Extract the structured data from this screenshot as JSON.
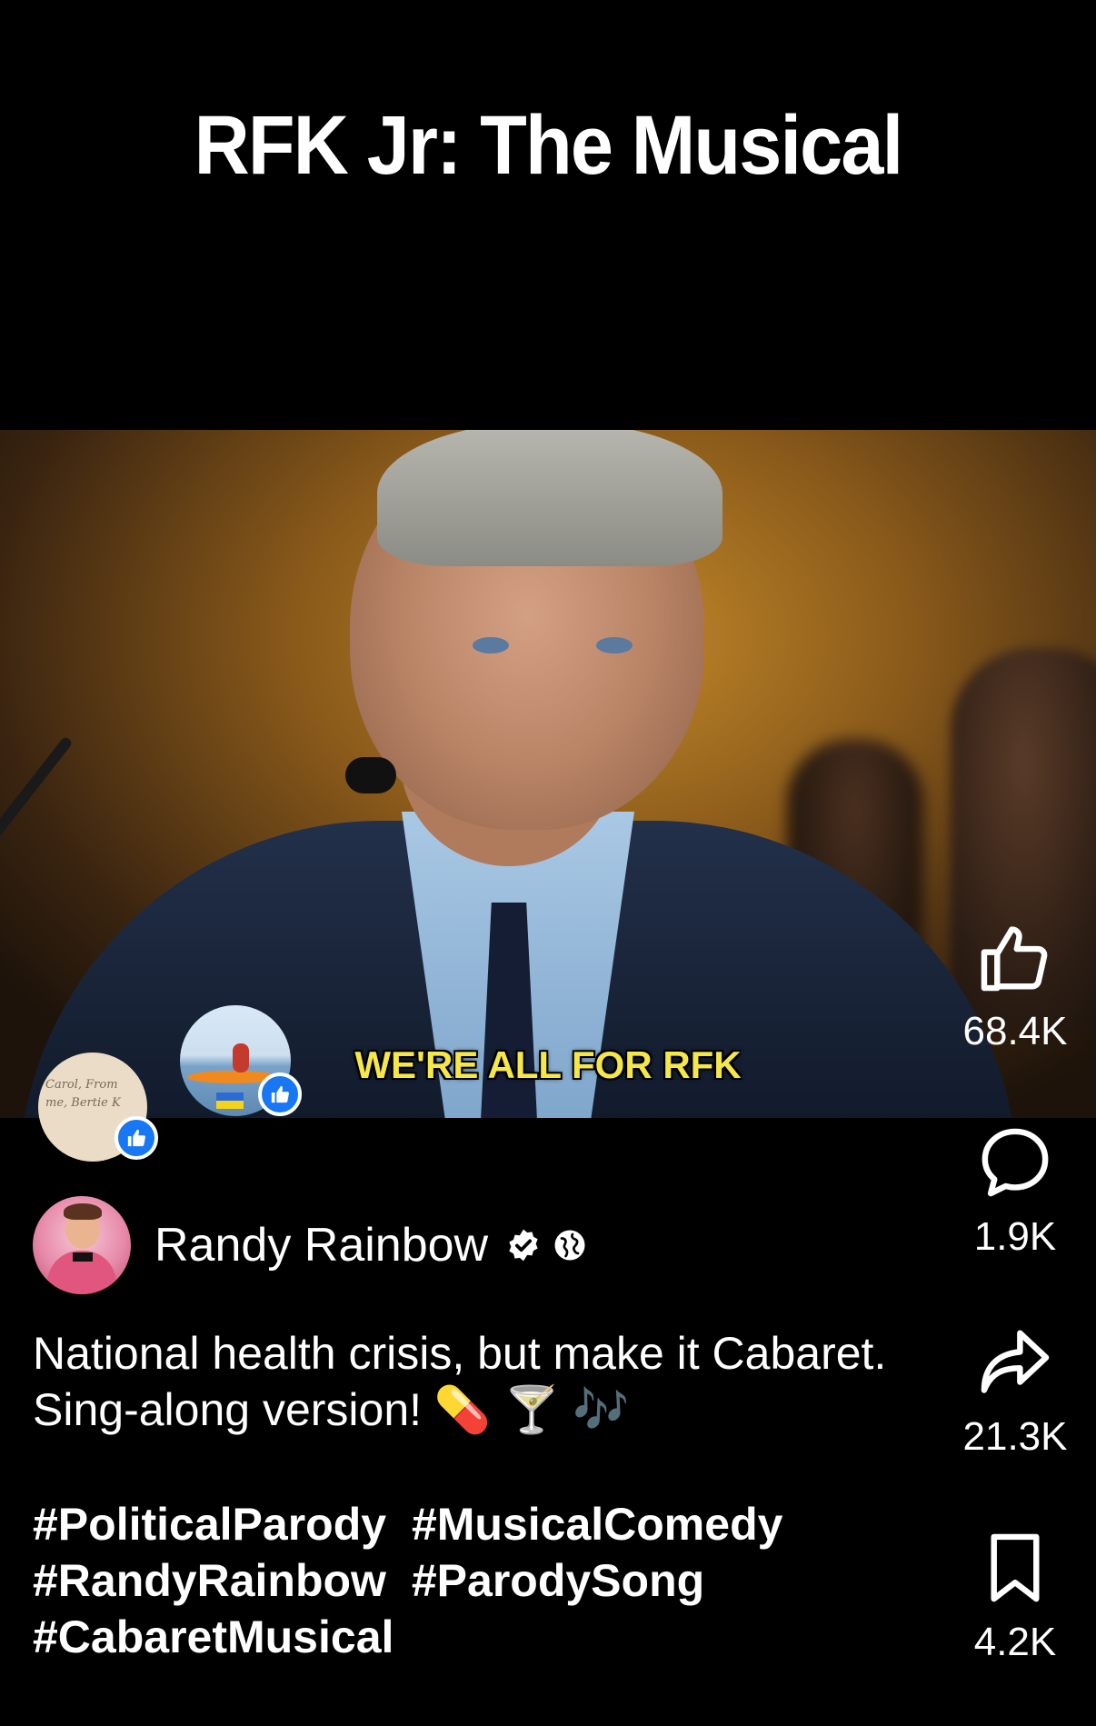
{
  "video": {
    "title": "RFK Jr: The Musical",
    "subtitle": "WE'RE ALL FOR RFK"
  },
  "reactors": [
    {
      "avatar_text": "Carol, From me, Bertie K",
      "badge": "like-icon"
    },
    {
      "avatar_scene": "kayak-ukraine",
      "badge": "like-icon"
    }
  ],
  "actions": {
    "like_count": "68.4K",
    "comment_count": "1.9K",
    "share_count": "21.3K",
    "save_count": "4.2K"
  },
  "author": {
    "name": "Randy Rainbow",
    "verified": true,
    "audience": "globe-icon"
  },
  "post": {
    "description": "National health crisis, but make it Cabaret. Sing-along version! 💊 🍸 🎶",
    "hashtags": [
      "#PoliticalParody",
      "#MusicalComedy",
      "#RandyRainbow",
      "#ParodySong",
      "#CabaretMusical"
    ]
  },
  "colors": {
    "background": "#000000",
    "subtitle": "#f4e64b",
    "like_badge": "#1877f2",
    "text": "#ffffff"
  }
}
